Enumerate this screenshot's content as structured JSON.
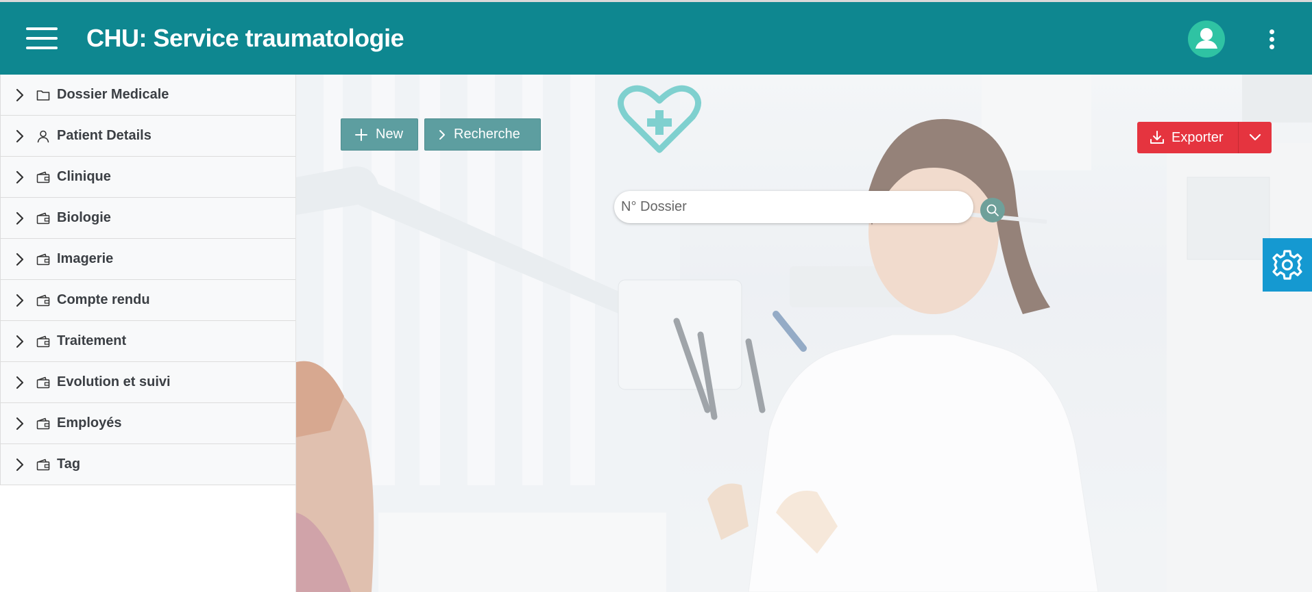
{
  "header": {
    "title": "CHU: Service traumatologie",
    "menu_icon": "hamburger-menu-icon",
    "avatar_icon": "user-icon",
    "more_icon": "kebab-menu-icon",
    "background_color": "#0e8790"
  },
  "sidebar": {
    "items": [
      {
        "label": "Dossier Medicale",
        "icon": "folder-icon"
      },
      {
        "label": "Patient Details",
        "icon": "person-icon"
      },
      {
        "label": "Clinique",
        "icon": "wallet-icon"
      },
      {
        "label": "Biologie",
        "icon": "wallet-icon"
      },
      {
        "label": "Imagerie",
        "icon": "wallet-icon"
      },
      {
        "label": "Compte rendu",
        "icon": "wallet-icon"
      },
      {
        "label": "Traitement",
        "icon": "wallet-icon"
      },
      {
        "label": "Evolution et suivi",
        "icon": "wallet-icon"
      },
      {
        "label": "Employés",
        "icon": "wallet-icon"
      },
      {
        "label": "Tag",
        "icon": "wallet-icon"
      }
    ]
  },
  "toolbar": {
    "new_label": "New",
    "search_label": "Recherche"
  },
  "search": {
    "placeholder": "N° Dossier",
    "value": ""
  },
  "export": {
    "label": "Exporter",
    "color": "#e5343f"
  },
  "accent_colors": {
    "teal_button": "#5d9ea0",
    "settings_tab": "#1599d1",
    "avatar": "#2fc3a3"
  }
}
